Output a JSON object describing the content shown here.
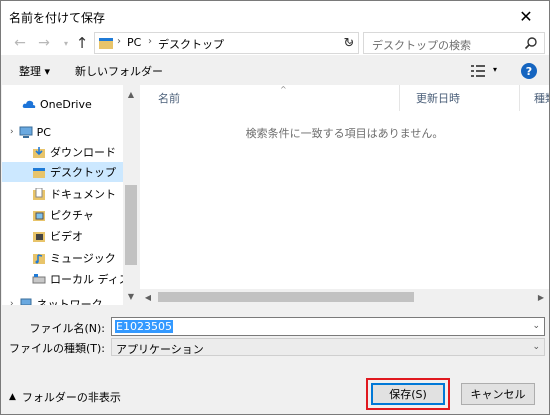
{
  "window": {
    "title": "名前を付けて保存",
    "close_glyph": "✕"
  },
  "nav": {
    "back_glyph": "←",
    "forward_glyph": "→",
    "recent_glyph": "▾",
    "up_glyph": "↑",
    "refresh_glyph": "↻"
  },
  "address": {
    "sep_glyph": "›",
    "crumbs": [
      "PC",
      "デスクトップ"
    ],
    "drop_glyph": "⌄"
  },
  "search": {
    "placeholder": "デスクトップの検索"
  },
  "toolbar": {
    "organize_label": "整理 ▾",
    "new_folder_label": "新しいフォルダー",
    "view_drop_glyph": "▾",
    "help_glyph": "?"
  },
  "sidebar": {
    "items": [
      {
        "label": "OneDrive",
        "icon": "onedrive-icon"
      },
      {
        "label": "PC",
        "icon": "pc-icon"
      },
      {
        "label": "ダウンロード",
        "icon": "downloads-icon"
      },
      {
        "label": "デスクトップ",
        "icon": "desktop-folder-icon",
        "selected": true
      },
      {
        "label": "ドキュメント",
        "icon": "documents-icon"
      },
      {
        "label": "ピクチャ",
        "icon": "pictures-icon"
      },
      {
        "label": "ビデオ",
        "icon": "videos-icon"
      },
      {
        "label": "ミュージック",
        "icon": "music-icon"
      },
      {
        "label": "ローカル ディスク (C",
        "icon": "local-disk-icon"
      },
      {
        "label": "ネットワーク",
        "icon": "network-icon"
      }
    ],
    "expand_glyph": "›",
    "scroll_up_glyph": "▲",
    "scroll_down_glyph": "▼"
  },
  "filelist": {
    "columns": [
      "名前",
      "更新日時",
      "種類"
    ],
    "sort_glyph": "^",
    "empty_message": "検索条件に一致する項目はありません。",
    "scroll_left_glyph": "◀",
    "scroll_right_glyph": "▶"
  },
  "form": {
    "filename_label": "ファイル名(N):",
    "filename_value": "E1023505",
    "filetype_label": "ファイルの種類(T):",
    "filetype_value": "アプリケーション",
    "drop_glyph": "⌄"
  },
  "footer": {
    "hide_folders_label": "フォルダーの非表示",
    "hide_folders_glyph": "▲",
    "save_label": "保存(S)",
    "cancel_label": "キャンセル"
  },
  "colors": {
    "accent": "#0078d7",
    "selection": "#cce8ff",
    "highlight_frame": "#e0191f",
    "help_icon": "#1565c0"
  }
}
